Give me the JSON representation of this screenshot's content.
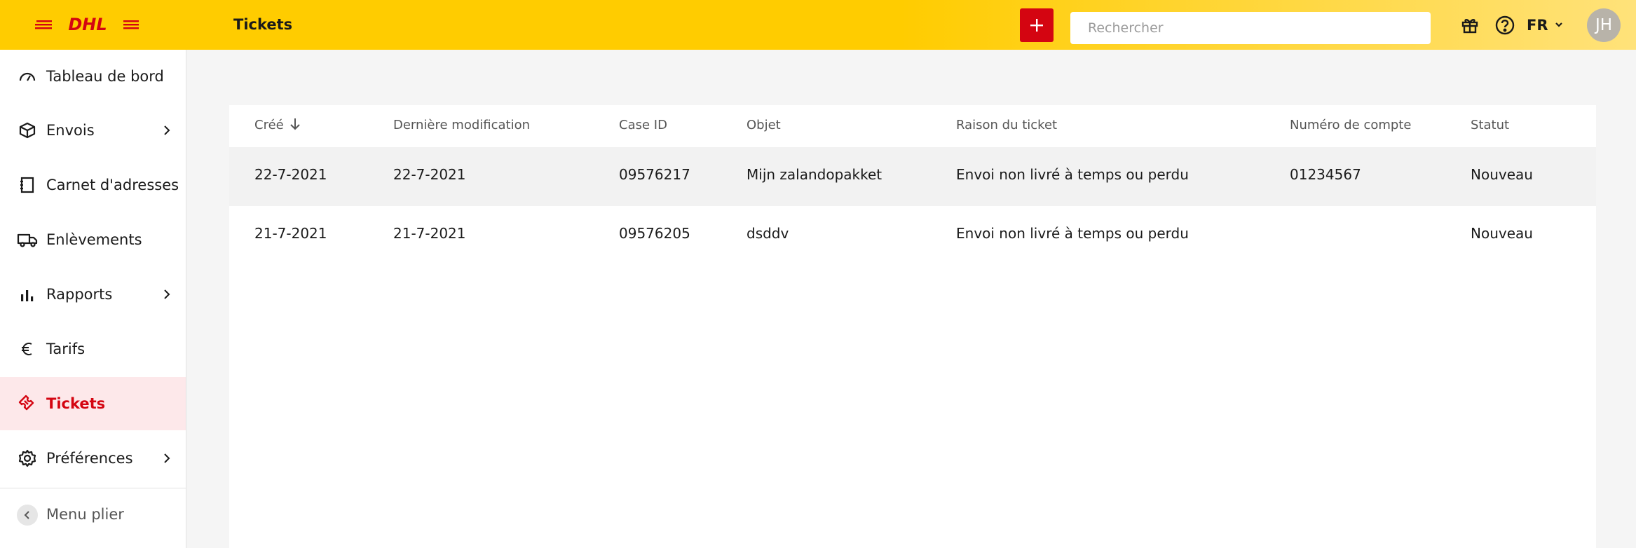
{
  "header": {
    "logo_text": "DHL",
    "title": "Tickets",
    "add_icon": "plus-icon",
    "search_placeholder": "Rechercher",
    "gift_icon": "gift-icon",
    "help_icon": "help-circle-icon",
    "language": "FR",
    "avatar_initials": "JH"
  },
  "sidebar": {
    "items": [
      {
        "label": "Tableau de bord",
        "icon": "speedometer-icon",
        "has_submenu": false
      },
      {
        "label": "Envois",
        "icon": "package-icon",
        "has_submenu": true
      },
      {
        "label": "Carnet d'adresses",
        "icon": "address-book-icon",
        "has_submenu": false
      },
      {
        "label": "Enlèvements",
        "icon": "truck-icon",
        "has_submenu": false
      },
      {
        "label": "Rapports",
        "icon": "bar-chart-icon",
        "has_submenu": true
      },
      {
        "label": "Tarifs",
        "icon": "euro-icon",
        "has_submenu": false
      },
      {
        "label": "Tickets",
        "icon": "ticket-icon",
        "has_submenu": false,
        "active": true
      },
      {
        "label": "Préférences",
        "icon": "gear-icon",
        "has_submenu": true
      }
    ],
    "collapse_label": "Menu plier"
  },
  "table": {
    "sort_column": "Créé",
    "sort_direction": "descending",
    "columns": [
      "Créé",
      "Dernière modification",
      "Case ID",
      "Objet",
      "Raison du ticket",
      "Numéro de compte",
      "Statut"
    ],
    "rows": [
      [
        "22-7-2021",
        "22-7-2021",
        "09576217",
        "Mijn zalandopakket",
        "Envoi non livré à temps ou perdu",
        "01234567",
        "Nouveau"
      ],
      [
        "21-7-2021",
        "21-7-2021",
        "09576205",
        "dsddv",
        "Envoi non livré à temps ou perdu",
        "",
        "Nouveau"
      ]
    ]
  },
  "colors": {
    "brand_yellow": "#ffcc00",
    "brand_red": "#d40511",
    "active_bg": "#fde8ea"
  }
}
